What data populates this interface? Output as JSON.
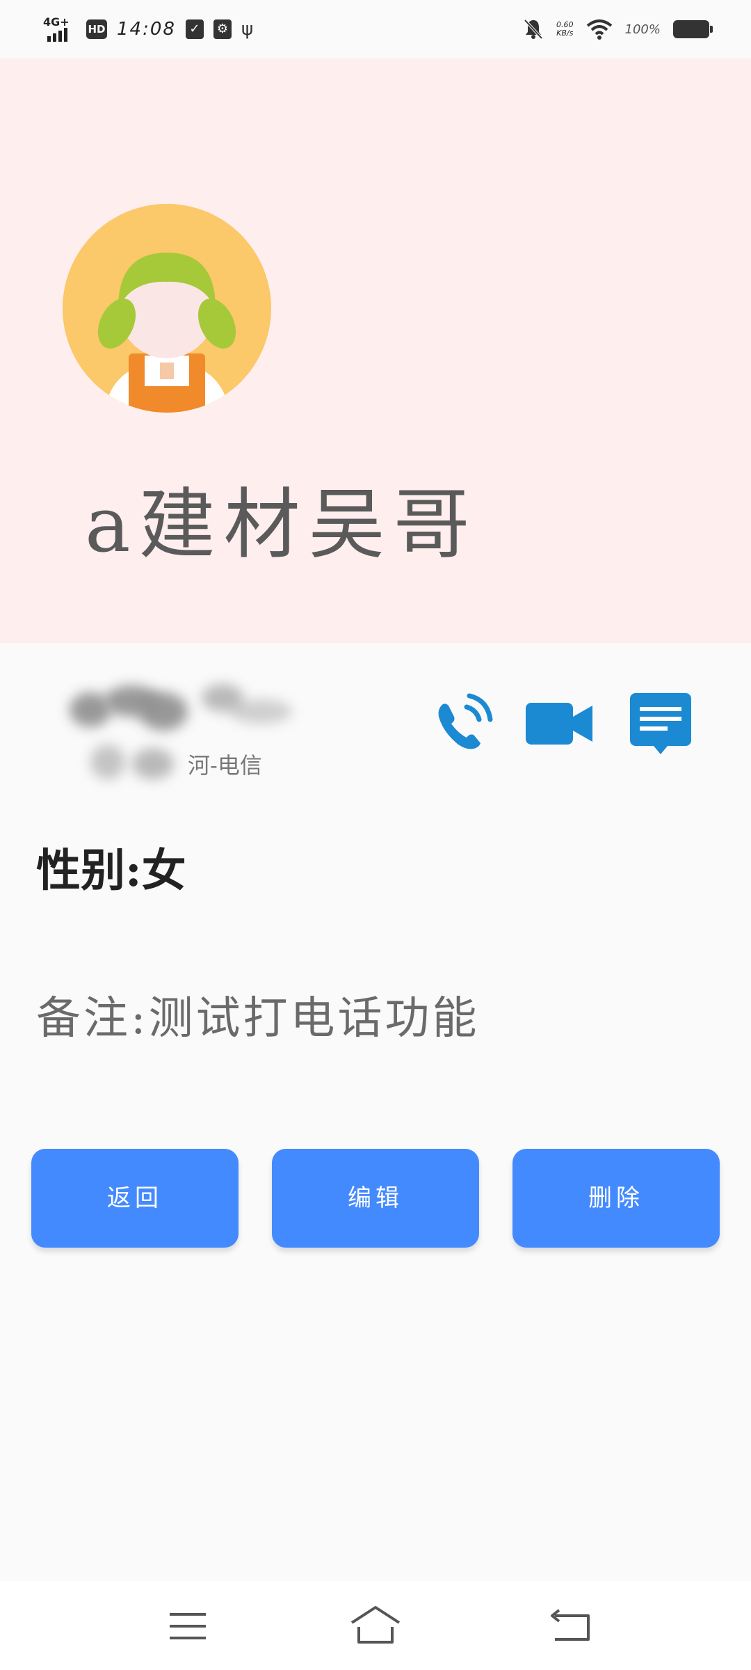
{
  "status_bar": {
    "network": "4G+",
    "hd": "HD",
    "time": "14:08",
    "speed_value": "0.60",
    "speed_unit": "KB/s",
    "battery": "100%",
    "icons": [
      "signal-icon",
      "check-clipboard-icon",
      "usb-debug-icon",
      "usb-icon",
      "mute-bell-icon",
      "wifi-icon",
      "battery-icon"
    ]
  },
  "profile": {
    "name": "a建材吴哥",
    "avatar": "avatar-girl-icon",
    "header_color": "#ffeeee"
  },
  "contact": {
    "carrier": "河-电信",
    "actions": [
      "phone-call-icon",
      "video-call-icon",
      "message-icon"
    ],
    "action_color": "#1b8ad3"
  },
  "details": {
    "gender_label": "性别:",
    "gender_value": "女",
    "remark_label": "备注:",
    "remark_value": "测试打电话功能"
  },
  "buttons": {
    "back": "返回",
    "edit": "编辑",
    "delete": "删除",
    "color": "#448aff"
  },
  "nav": {
    "icons": [
      "menu-icon",
      "home-icon",
      "back-icon"
    ]
  }
}
